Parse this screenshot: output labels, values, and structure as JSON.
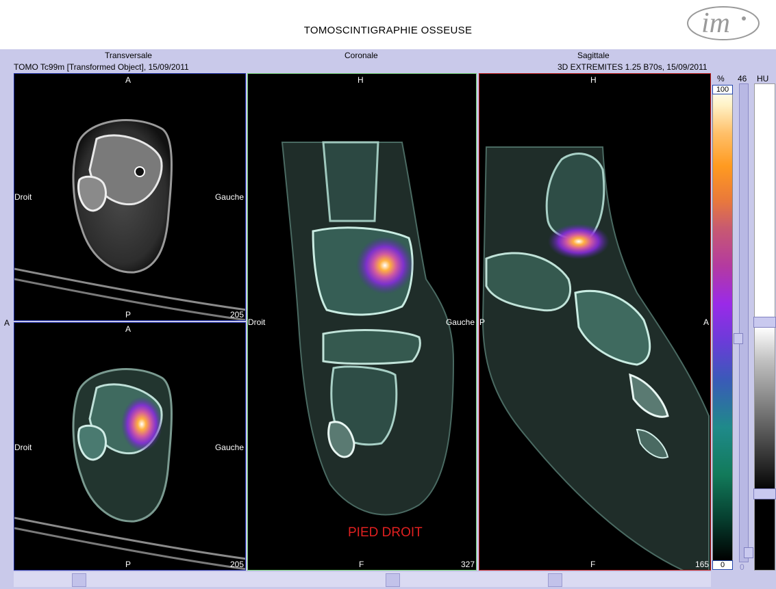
{
  "title": "TOMOSCINTIGRAPHIE OSSEUSE",
  "logo_text": "im",
  "views": {
    "transverse": "Transversale",
    "coronal": "Coronale",
    "sagittal": "Sagittale"
  },
  "series_left": "TOMO Tc99m [Transformed Object], 15/09/2011",
  "series_right": "3D EXTREMITES  1.25  B70s, 15/09/2011",
  "orientation": {
    "A": "A",
    "P": "P",
    "H": "H",
    "F": "F",
    "droit": "Droit",
    "gauche": "Gauche"
  },
  "slices": {
    "transverse_top": "205",
    "transverse_bottom": "205",
    "coronal": "327",
    "sagittal": "165"
  },
  "annotation": "PIED DROIT",
  "colorbar": {
    "percent_label": "%",
    "value_label": "46",
    "hu_label": "HU",
    "max": "100",
    "min": "0",
    "bottom_value": "0"
  },
  "colors": {
    "frame_transverse": "#1a2aa0",
    "frame_coronal": "#6fcf6f",
    "frame_sagittal": "#c21a1a",
    "annotation": "#e02020",
    "background": "#c9c9ea"
  }
}
